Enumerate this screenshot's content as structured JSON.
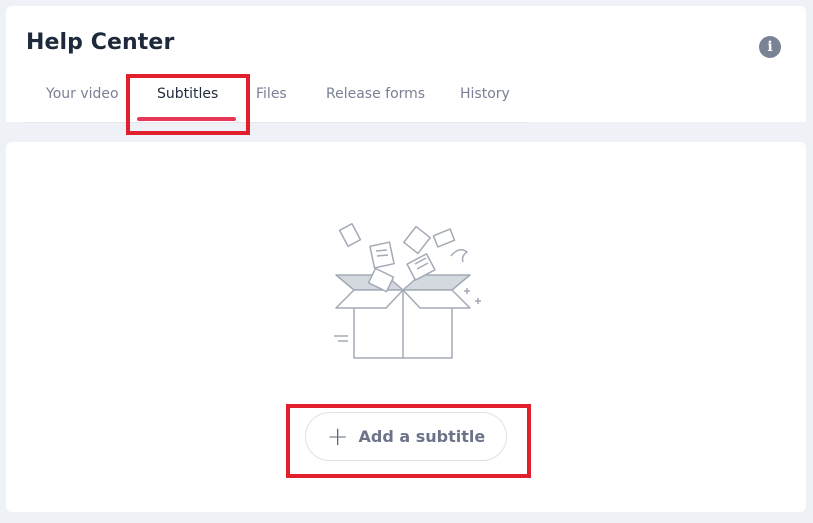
{
  "header": {
    "title": "Help Center",
    "info_icon": "info-icon"
  },
  "tabs": [
    {
      "label": "Your video",
      "active": false
    },
    {
      "label": "Subtitles",
      "active": true
    },
    {
      "label": "Files",
      "active": false
    },
    {
      "label": "Release forms",
      "active": false
    },
    {
      "label": "History",
      "active": false
    }
  ],
  "empty_state": {
    "illustration": "open-box-with-flying-papers",
    "add_button_label": "Add a subtitle",
    "add_button_icon": "plus-icon"
  },
  "colors": {
    "accent": "#e8385a",
    "highlight_border": "#e21f2c",
    "title": "#1e2a3b",
    "muted_text": "#7a8094",
    "background": "#eef1f5"
  }
}
